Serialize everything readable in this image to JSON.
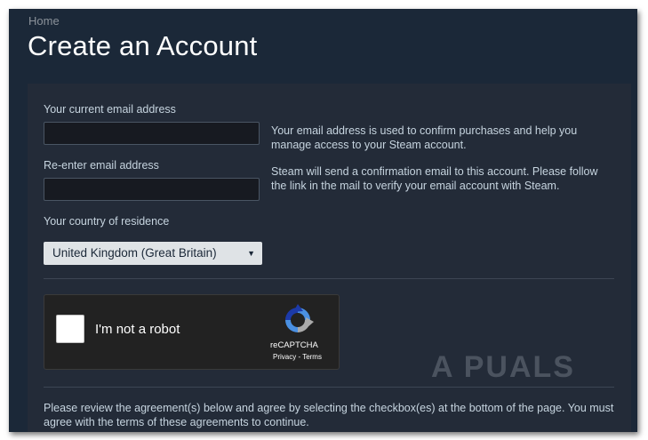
{
  "breadcrumb": "Home",
  "page_title": "Create an Account",
  "form": {
    "email_label": "Your current email address",
    "email_value": "",
    "reenter_label": "Re-enter email address",
    "reenter_value": "",
    "country_label": "Your country of residence",
    "country_selected": "United Kingdom (Great Britain)"
  },
  "help": {
    "paragraph1": "Your email address is used to confirm purchases and help you manage access to your Steam account.",
    "paragraph2": "Steam will send a confirmation email to this account. Please follow the link in the mail to verify your email account with Steam."
  },
  "recaptcha": {
    "label": "I'm not a robot",
    "brand": "reCAPTCHA",
    "links": "Privacy - Terms",
    "checked": false
  },
  "agreement_text": "Please review the agreement(s) below and agree by selecting the checkbox(es) at the bottom of the page. You must agree with the terms of these agreements to continue.",
  "watermark": "A PUALS",
  "colors": {
    "background": "#1b2838",
    "panel": "#232b38",
    "input": "#171a21",
    "text": "#c6d4df"
  }
}
